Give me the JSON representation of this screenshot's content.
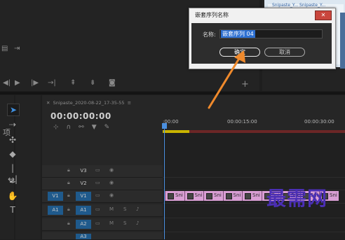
{
  "dialog": {
    "title": "嵌套序列名称",
    "close_label": "✕",
    "name_label": "名称:",
    "name_value": "嵌套序列 04",
    "ok_label": "确定",
    "cancel_label": "取消"
  },
  "thumbnail": {
    "text": "Snipaste_Y... Snipaste_Y..."
  },
  "project_panel": {
    "label": "项"
  },
  "timeline": {
    "tab_title": "Snipaste_2020-08-22_17-35-55",
    "timecode": "00:00:00:00",
    "ruler": [
      ":00:00",
      "00:00:15:00",
      "00:00:30:00"
    ],
    "tracks": [
      {
        "source": "",
        "name": "V3",
        "kind": "video"
      },
      {
        "source": "",
        "name": "V2",
        "kind": "video"
      },
      {
        "source": "V1",
        "name": "V1",
        "kind": "video"
      },
      {
        "source": "A1",
        "name": "A1",
        "kind": "audio"
      },
      {
        "source": "",
        "name": "A2",
        "kind": "audio"
      },
      {
        "source": "",
        "name": "A3",
        "kind": "audio"
      }
    ],
    "clip_label": "Sni",
    "clips": [
      "Sni",
      "Sni",
      "Sni",
      "Sni",
      "Sni",
      "Sni",
      "Sni",
      "Sni",
      "Sni"
    ]
  },
  "audio_track_labels": {
    "mute": "M",
    "solo": "S"
  },
  "watermark": "最需网",
  "colors": {
    "accent_blue": "#1f5a8c",
    "clip_pink": "#d99ed4",
    "arrow_orange": "#f08a2c",
    "watermark_purple": "#4b2fb5"
  }
}
